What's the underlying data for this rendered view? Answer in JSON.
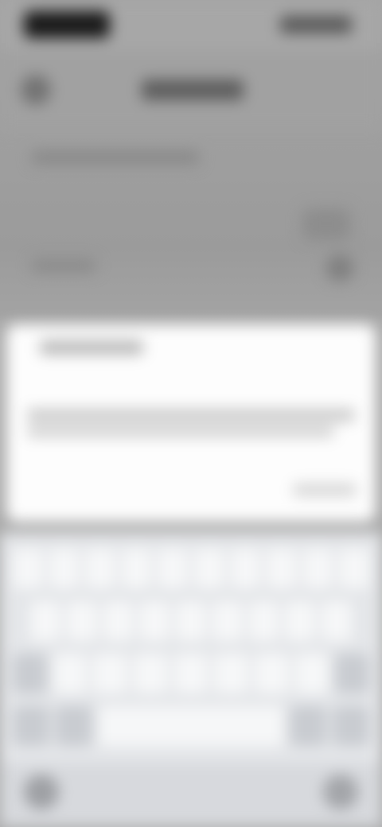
{
  "screen": {
    "description_visible_text": "",
    "colors": {
      "scrim": "#9c9c9c",
      "dialog": "#fdfdfd",
      "keyboard": "#e4e6e9",
      "keyboard_bottom": "#d7d9dd"
    }
  },
  "status_bar": {
    "time": "",
    "icons": [
      "signal-icon",
      "wifi-icon",
      "battery-icon"
    ]
  },
  "app_bar": {
    "title": "",
    "back_icon": "back-arrow-icon"
  },
  "content": {
    "line": "",
    "row_label": ""
  },
  "dialog": {
    "title": "",
    "body": "",
    "action": ""
  },
  "keyboard": {
    "rows": [
      10,
      9,
      9
    ],
    "space_label": ""
  },
  "bottom_bar": {
    "left_icon": "keyboard-hide-icon",
    "right_icon": "mic-icon"
  }
}
